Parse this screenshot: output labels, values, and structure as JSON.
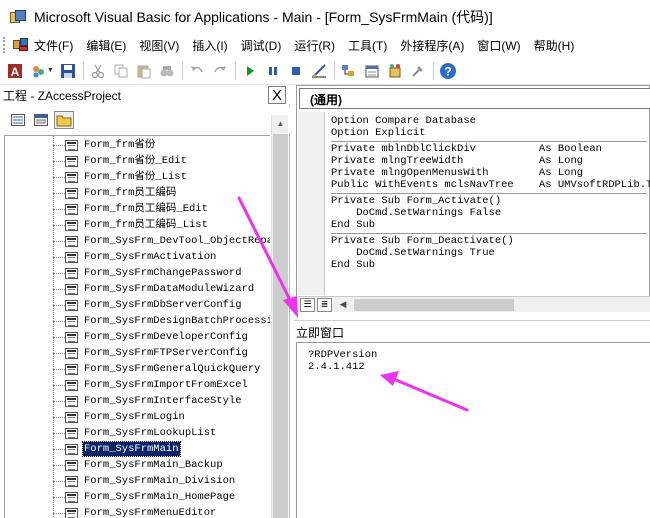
{
  "window": {
    "title": "Microsoft Visual Basic for Applications - Main - [Form_SysFrmMain (代码)]"
  },
  "menubar": {
    "items": [
      {
        "label": "文件(F)"
      },
      {
        "label": "编辑(E)"
      },
      {
        "label": "视图(V)"
      },
      {
        "label": "插入(I)"
      },
      {
        "label": "调试(D)"
      },
      {
        "label": "运行(R)"
      },
      {
        "label": "工具(T)"
      },
      {
        "label": "外接程序(A)"
      },
      {
        "label": "窗口(W)"
      },
      {
        "label": "帮助(H)"
      }
    ]
  },
  "toolbar": {
    "help_glyph": "?"
  },
  "project_explorer": {
    "title": "工程 - ZAccessProject",
    "close_glyph": "X",
    "items": [
      {
        "label": "Form_frm省份"
      },
      {
        "label": "Form_frm省份_Edit"
      },
      {
        "label": "Form_frm省份_List"
      },
      {
        "label": "Form_frm员工编码"
      },
      {
        "label": "Form_frm员工编码_Edit"
      },
      {
        "label": "Form_frm员工编码_List"
      },
      {
        "label": "Form_SysFrm_DevTool_ObjectRepai"
      },
      {
        "label": "Form_SysFrmActivation"
      },
      {
        "label": "Form_SysFrmChangePassword"
      },
      {
        "label": "Form_SysFrmDataModuleWizard"
      },
      {
        "label": "Form_SysFrmDbServerConfig"
      },
      {
        "label": "Form_SysFrmDesignBatchProcessin"
      },
      {
        "label": "Form_SysFrmDeveloperConfig"
      },
      {
        "label": "Form_SysFrmFTPServerConfig"
      },
      {
        "label": "Form_SysFrmGeneralQuickQuery"
      },
      {
        "label": "Form_SysFrmImportFromExcel"
      },
      {
        "label": "Form_SysFrmInterfaceStyle"
      },
      {
        "label": "Form_SysFrmLogin"
      },
      {
        "label": "Form_SysFrmLookupList"
      },
      {
        "label": "Form_SysFrmMain",
        "selected": true
      },
      {
        "label": "Form_SysFrmMain_Backup"
      },
      {
        "label": "Form_SysFrmMain_Division"
      },
      {
        "label": "Form_SysFrmMain_HomePage"
      },
      {
        "label": "Form_SysFrmMenuEditor"
      }
    ]
  },
  "code_window": {
    "object_combo": "(通用)",
    "sections": [
      [
        "Option Compare Database",
        "Option Explicit"
      ],
      [
        "Private mblnDblClickDiv          As Boolean",
        "Private mlngTreeWidth            As Long",
        "Private mlngOpenMenusWith        As Long",
        "Public WithEvents mclsNavTree    As UMVsoftRDPLib.TreeV"
      ],
      [
        "Private Sub Form_Activate()",
        "    DoCmd.SetWarnings False",
        "End Sub"
      ],
      [
        "Private Sub Form_Deactivate()",
        "    DoCmd.SetWarnings True",
        "End Sub"
      ]
    ]
  },
  "immediate_window": {
    "title": "立即窗口",
    "lines": [
      "?RDPVersion",
      "2.4.1.412"
    ]
  },
  "colors": {
    "selection": "#0a246a",
    "annotation_arrow": "#ee33ee",
    "run_green": "#1a9a1a"
  }
}
